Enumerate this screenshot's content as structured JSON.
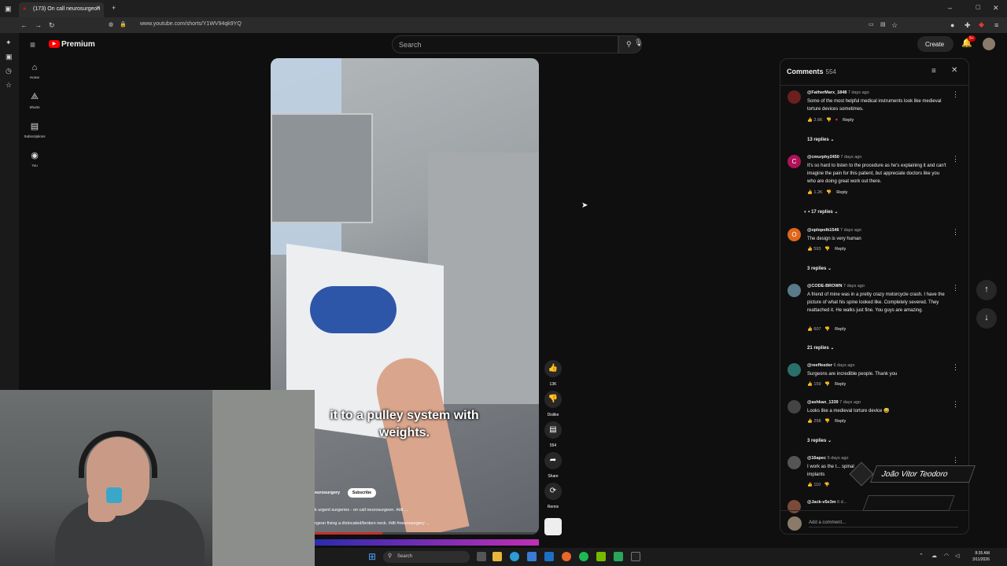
{
  "browser": {
    "tab_title": "(173) On call neurosurgeon",
    "url": "www.youtube.com/shorts/Y1WV94qk9YQ"
  },
  "header": {
    "logo": "Premium",
    "search_placeholder": "Search",
    "create_label": "Create",
    "notifications_badge": "9+"
  },
  "nav": {
    "items": [
      {
        "label": "Home",
        "icon": "home-icon"
      },
      {
        "label": "Shorts",
        "icon": "shorts-icon"
      },
      {
        "label": "Subscriptions",
        "icon": "subscriptions-icon"
      },
      {
        "label": "You",
        "icon": "you-icon"
      }
    ]
  },
  "video": {
    "caption": "it to a pulley system with weights.",
    "channel": "eurosurgery",
    "subscribe_label": "Subscribe",
    "line1": "k urgent surgeries - on call neurosurgeon. #dtl ...",
    "line2": "rgeon fixing a dislocated/broken neck. #dtl #neurosurgery ...",
    "progress": 0.3
  },
  "actions": {
    "like_count": "13K",
    "dislike_label": "Dislike",
    "comments_count": "554",
    "share_label": "Share",
    "remix_label": "Remix"
  },
  "comments": {
    "title": "Comments",
    "count": "554",
    "add_placeholder": "Add a comment...",
    "items": [
      {
        "handle": "@FatherMarx_1848",
        "ago": "7 days ago",
        "text": "Some of the most helpful medical instruments look like medieval torture devices sometimes.",
        "likes": "2.6K",
        "reply": "Reply",
        "replies": "13 replies",
        "avatar_color": "#6b1f1f",
        "avatar_letter": ""
      },
      {
        "handle": "@cmurphy2450",
        "ago": "7 days ago",
        "text": "It's so hard to listen to the procedure as he's explaining it and can't imagine the pain for this patient, but appreciate doctors like you who are doing great work out there.",
        "likes": "1.2K",
        "reply": "Reply",
        "replies": "• 17 replies",
        "avatar_color": "#b0125a",
        "avatar_letter": "C"
      },
      {
        "handle": "@oplopolk1546",
        "ago": "7 days ago",
        "text": "The design is very human",
        "likes": "593",
        "reply": "Reply",
        "replies": "3 replies",
        "avatar_color": "#e0661c",
        "avatar_letter": "O"
      },
      {
        "handle": "@CODE-BROWN",
        "ago": "7 days ago",
        "text": "A friend of mine was in a pretty crazy motorcycle crash. I have the picture of what his spine looked like. Completely severed. They reattached it. He walks just fine. You guys are amazing.",
        "likes": "607",
        "reply": "Reply",
        "replies": "21 replies",
        "avatar_color": "#5a7a8a",
        "avatar_letter": ""
      },
      {
        "handle": "@reeffeeder",
        "ago": "6 days ago",
        "text": "Surgeons are incredible people. Thank you",
        "likes": "159",
        "reply": "Reply",
        "replies": "",
        "avatar_color": "#2a6f6a",
        "avatar_letter": ""
      },
      {
        "handle": "@ashkan_1339",
        "ago": "7 days ago",
        "text": "Looks like a medieval torture device 😅",
        "likes": "258",
        "reply": "Reply",
        "replies": "3 replies",
        "avatar_color": "#444444",
        "avatar_letter": ""
      },
      {
        "handle": "@16apec",
        "ago": "5 days ago",
        "text": "I work as the t... spinal implants",
        "likes": "110",
        "reply": "",
        "replies": "",
        "avatar_color": "#555555",
        "avatar_letter": ""
      },
      {
        "handle": "@Jack-v5e3m",
        "ago": "6 d...",
        "text": "",
        "likes": "",
        "reply": "",
        "replies": "",
        "avatar_color": "#7a4a3a",
        "avatar_letter": ""
      }
    ]
  },
  "overlay": {
    "name": "João Vitor Teodoro"
  },
  "taskbar": {
    "search_label": "Search",
    "time": "8:35 AM",
    "date": "3/11/2026"
  },
  "colors": {
    "accent": "#ff0000",
    "background": "#0f0f0f"
  }
}
